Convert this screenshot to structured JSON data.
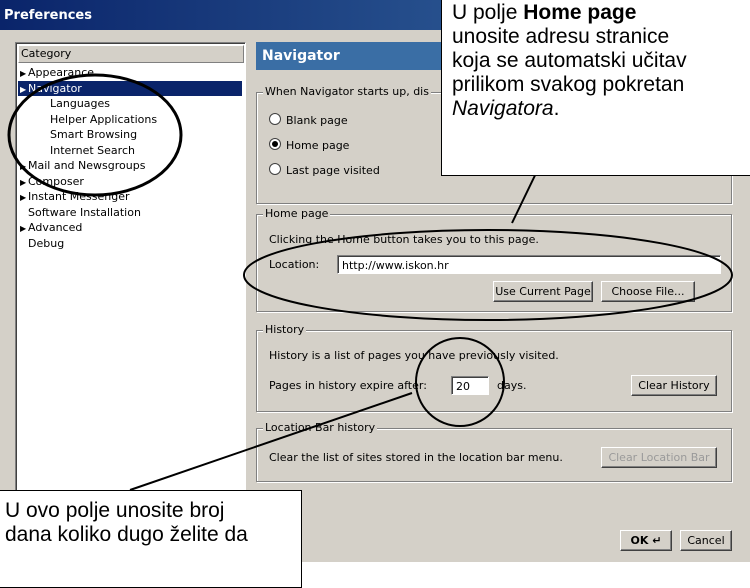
{
  "window": {
    "title": "Preferences"
  },
  "category": {
    "header": "Category",
    "items": [
      {
        "label": "Appearance",
        "arrow": true,
        "indent": 0
      },
      {
        "label": "Navigator",
        "arrow": true,
        "indent": 0,
        "selected": true
      },
      {
        "label": "Languages",
        "arrow": false,
        "indent": 1
      },
      {
        "label": "Helper Applications",
        "arrow": false,
        "indent": 1
      },
      {
        "label": "Smart Browsing",
        "arrow": false,
        "indent": 1
      },
      {
        "label": "Internet Search",
        "arrow": false,
        "indent": 1
      },
      {
        "label": "Mail and Newsgroups",
        "arrow": true,
        "indent": 0
      },
      {
        "label": "Composer",
        "arrow": true,
        "indent": 0
      },
      {
        "label": "Instant Messenger",
        "arrow": true,
        "indent": 0
      },
      {
        "label": "Software Installation",
        "arrow": false,
        "indent": 0
      },
      {
        "label": "Advanced",
        "arrow": true,
        "indent": 0
      },
      {
        "label": "Debug",
        "arrow": false,
        "indent": 0
      }
    ]
  },
  "navigator": {
    "header": "Navigator",
    "startup": {
      "legend": "When Navigator starts up, dis",
      "options": [
        "Blank page",
        "Home page",
        "Last page visited"
      ],
      "selected": "Home page"
    },
    "homepage": {
      "legend": "Home page",
      "description": "Clicking the Home button takes you to this page.",
      "location_label": "Location:",
      "location_value": "http://www.iskon.hr",
      "use_current_label": "Use Current Page",
      "choose_file_label": "Choose File..."
    },
    "history": {
      "legend": "History",
      "description": "History is a list of pages you have previously visited.",
      "expire_label": "Pages in history expire after:",
      "expire_value": "20",
      "days_label": "days.",
      "clear_label": "Clear History"
    },
    "locationbar": {
      "legend": "Location Bar history",
      "description": "Clear the list of sites stored in the location bar menu.",
      "clear_label": "Clear Location Bar"
    }
  },
  "footer": {
    "ok_label": "OK",
    "cancel_label": "Cancel"
  },
  "callouts": {
    "top_pre": "U polje ",
    "top_bold": "Home page",
    "top_line2": "unosite adresu stranice",
    "top_line3": "koja se automatski učitav",
    "top_line4": "prilikom svakog pokretan",
    "top_italic": "Navigatora",
    "top_end": ".",
    "bottom_line1": "U ovo polje unosite broj",
    "bottom_line2": "dana koliko dugo želite da"
  }
}
